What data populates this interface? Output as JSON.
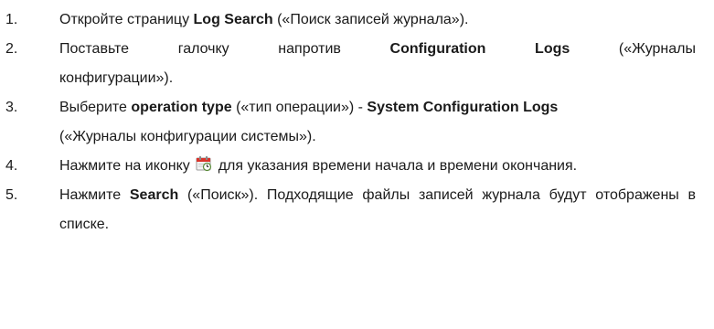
{
  "steps": [
    {
      "number": "1.",
      "t1": "Откройте страницу ",
      "b1": "Log Search",
      "t2": " («Поиск записей журнала»)."
    },
    {
      "number": "2.",
      "line1_t1": "Поставьте галочку напротив ",
      "line1_b1": "Configuration Logs",
      "line1_t2": " («Журналы",
      "line2": "конфигурации»)."
    },
    {
      "number": "3.",
      "t1": "Выберите ",
      "b1": "operation type",
      "t2": " («тип операции») - ",
      "b2": "System Configuration Logs",
      "t3": "(«Журналы конфигурации системы»)."
    },
    {
      "number": "4.",
      "t1": "Нажмите на иконку ",
      "icon": "calendar-clock-icon",
      "t2": " для указания времени начала и времени окончания."
    },
    {
      "number": "5.",
      "t1": "Нажмите ",
      "b1": "Search",
      "t2": " («Поиск»). Подходящие файлы записей журнала будут отображены в списке."
    }
  ],
  "colors": {
    "text": "#1a1a1a",
    "icon_red": "#d9342b",
    "icon_page": "#f4f4f4"
  }
}
